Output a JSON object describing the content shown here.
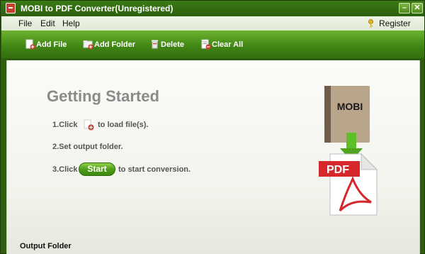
{
  "window": {
    "title": "MOBI to PDF Converter(Unregistered)",
    "minimize_glyph": "–",
    "close_glyph": "✕"
  },
  "menu": {
    "file": "File",
    "edit": "Edit",
    "help": "Help",
    "register": "Register"
  },
  "toolbar": {
    "add_file": "Add File",
    "add_folder": "Add Folder",
    "delete": "Delete",
    "clear_all": "Clear All"
  },
  "main": {
    "heading": "Getting Started",
    "step1_before": "1.Click",
    "step1_after": "to load file(s).",
    "step2": "2.Set output folder.",
    "step3_before": "3.Click",
    "start_label": "Start",
    "step3_after": "to start conversion.",
    "book_label": "MOBI",
    "pdf_label": "PDF",
    "output_folder_label": "Output Folder"
  },
  "colors": {
    "title_bar": "#2b5f0d",
    "toolbar": "#3f8414",
    "start_button": "#4c9a17",
    "heading": "#8a8a8a",
    "pdf_red": "#d6282a",
    "book": "#8a7560"
  },
  "icons": {
    "app": "app-icon",
    "register": "key-icon",
    "add_file": "add-file-icon",
    "add_folder": "add-folder-icon",
    "delete": "trash-icon",
    "clear_all": "clear-list-icon",
    "load": "add-file-icon",
    "conversion": "mobi-to-pdf-illustration"
  }
}
